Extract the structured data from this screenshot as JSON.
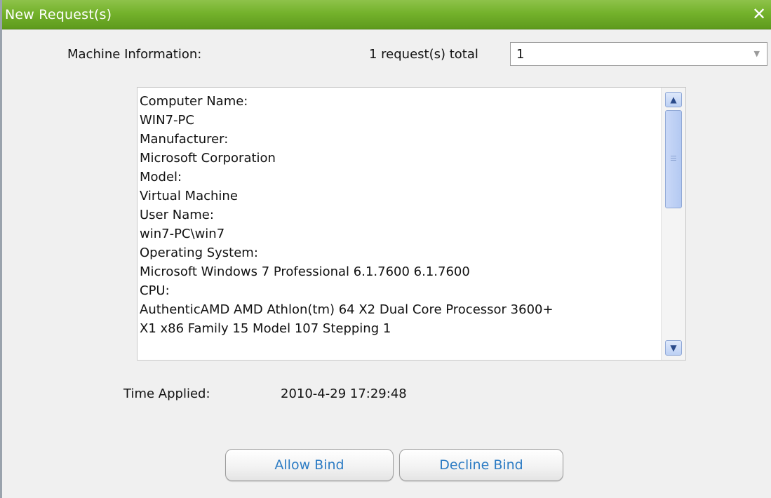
{
  "dialog": {
    "title": "New Request(s)",
    "close_glyph": "✕",
    "close_icon": "close-icon"
  },
  "machine_info_label": "Machine Information:",
  "requests_total_label": "1 request(s) total",
  "request_select": {
    "selected_value": "1",
    "arrow_glyph": "▼",
    "arrow_icon": "chevron-down-icon"
  },
  "info_lines": [
    "Computer Name:",
    "WIN7-PC",
    "Manufacturer:",
    "Microsoft Corporation",
    "Model:",
    "Virtual Machine",
    "User Name:",
    "win7-PC\\win7",
    "Operating System:",
    "Microsoft Windows 7 Professional 6.1.7600 6.1.7600",
    "CPU:",
    "AuthenticAMD AMD Athlon(tm) 64 X2 Dual Core Processor 3600+",
    "X1 x86 Family 15 Model 107 Stepping 1"
  ],
  "scrollbar": {
    "up_glyph": "▲",
    "down_glyph": "▼"
  },
  "time_applied": {
    "label": "Time Applied:",
    "value": "2010-4-29 17:29:48"
  },
  "buttons": {
    "allow": "Allow  Bind",
    "decline": "Decline  Bind"
  },
  "colors": {
    "titlebar": "#74b22c",
    "button_text": "#2d7cc4",
    "scrollbar_thumb": "#c9d8f7"
  }
}
